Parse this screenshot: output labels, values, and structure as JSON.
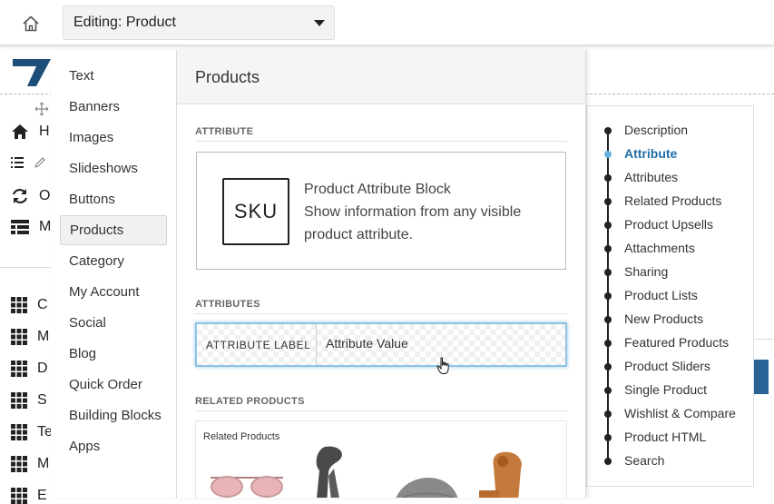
{
  "topbar": {
    "home_icon": "home-icon",
    "editing_select": "Editing: Product"
  },
  "background": {
    "left_items": [
      {
        "icon": "home-solid-icon",
        "label": "H"
      },
      {
        "icon": "list-icon",
        "label": ""
      },
      {
        "icon": "refresh-icon",
        "label": "O"
      },
      {
        "icon": "table-icon",
        "label": "M"
      }
    ],
    "grid_items": [
      {
        "icon": "grid-icon",
        "label": "C"
      },
      {
        "icon": "grid-icon",
        "label": "M"
      },
      {
        "icon": "grid-icon",
        "label": "D"
      },
      {
        "icon": "grid-icon",
        "label": "S"
      },
      {
        "icon": "grid-icon",
        "label": "Te"
      },
      {
        "icon": "grid-icon",
        "label": "M"
      },
      {
        "icon": "grid-icon",
        "label": "E"
      }
    ],
    "accent_color": "#2a6496"
  },
  "menu": {
    "items": [
      {
        "label": "Text"
      },
      {
        "label": "Banners"
      },
      {
        "label": "Images"
      },
      {
        "label": "Slideshows"
      },
      {
        "label": "Buttons"
      },
      {
        "label": "Products",
        "active": true
      },
      {
        "label": "Category"
      },
      {
        "label": "My Account"
      },
      {
        "label": "Social"
      },
      {
        "label": "Blog"
      },
      {
        "label": "Quick Order"
      },
      {
        "label": "Building Blocks"
      },
      {
        "label": "Apps"
      }
    ]
  },
  "panel": {
    "title": "Products",
    "attribute_section": "ATTRIBUTE",
    "sku_icon_text": "SKU",
    "sku_title": "Product Attribute Block",
    "sku_desc": "Show information from any visible product attribute.",
    "attributes_section": "ATTRIBUTES",
    "attr_label": "ATTRIBUTE LABEL",
    "attr_value": "Attribute Value",
    "related_section": "RELATED PRODUCTS",
    "related_title": "Related Products"
  },
  "right_list": {
    "items": [
      {
        "label": "Description"
      },
      {
        "label": "Attribute",
        "active": true
      },
      {
        "label": "Attributes"
      },
      {
        "label": "Related Products"
      },
      {
        "label": "Product Upsells"
      },
      {
        "label": "Attachments"
      },
      {
        "label": "Sharing"
      },
      {
        "label": "Product Lists"
      },
      {
        "label": "New Products"
      },
      {
        "label": "Featured Products"
      },
      {
        "label": "Product Sliders"
      },
      {
        "label": "Single Product"
      },
      {
        "label": "Wishlist & Compare"
      },
      {
        "label": "Product HTML"
      },
      {
        "label": "Search"
      }
    ],
    "active_color": "#1f6ea8"
  }
}
